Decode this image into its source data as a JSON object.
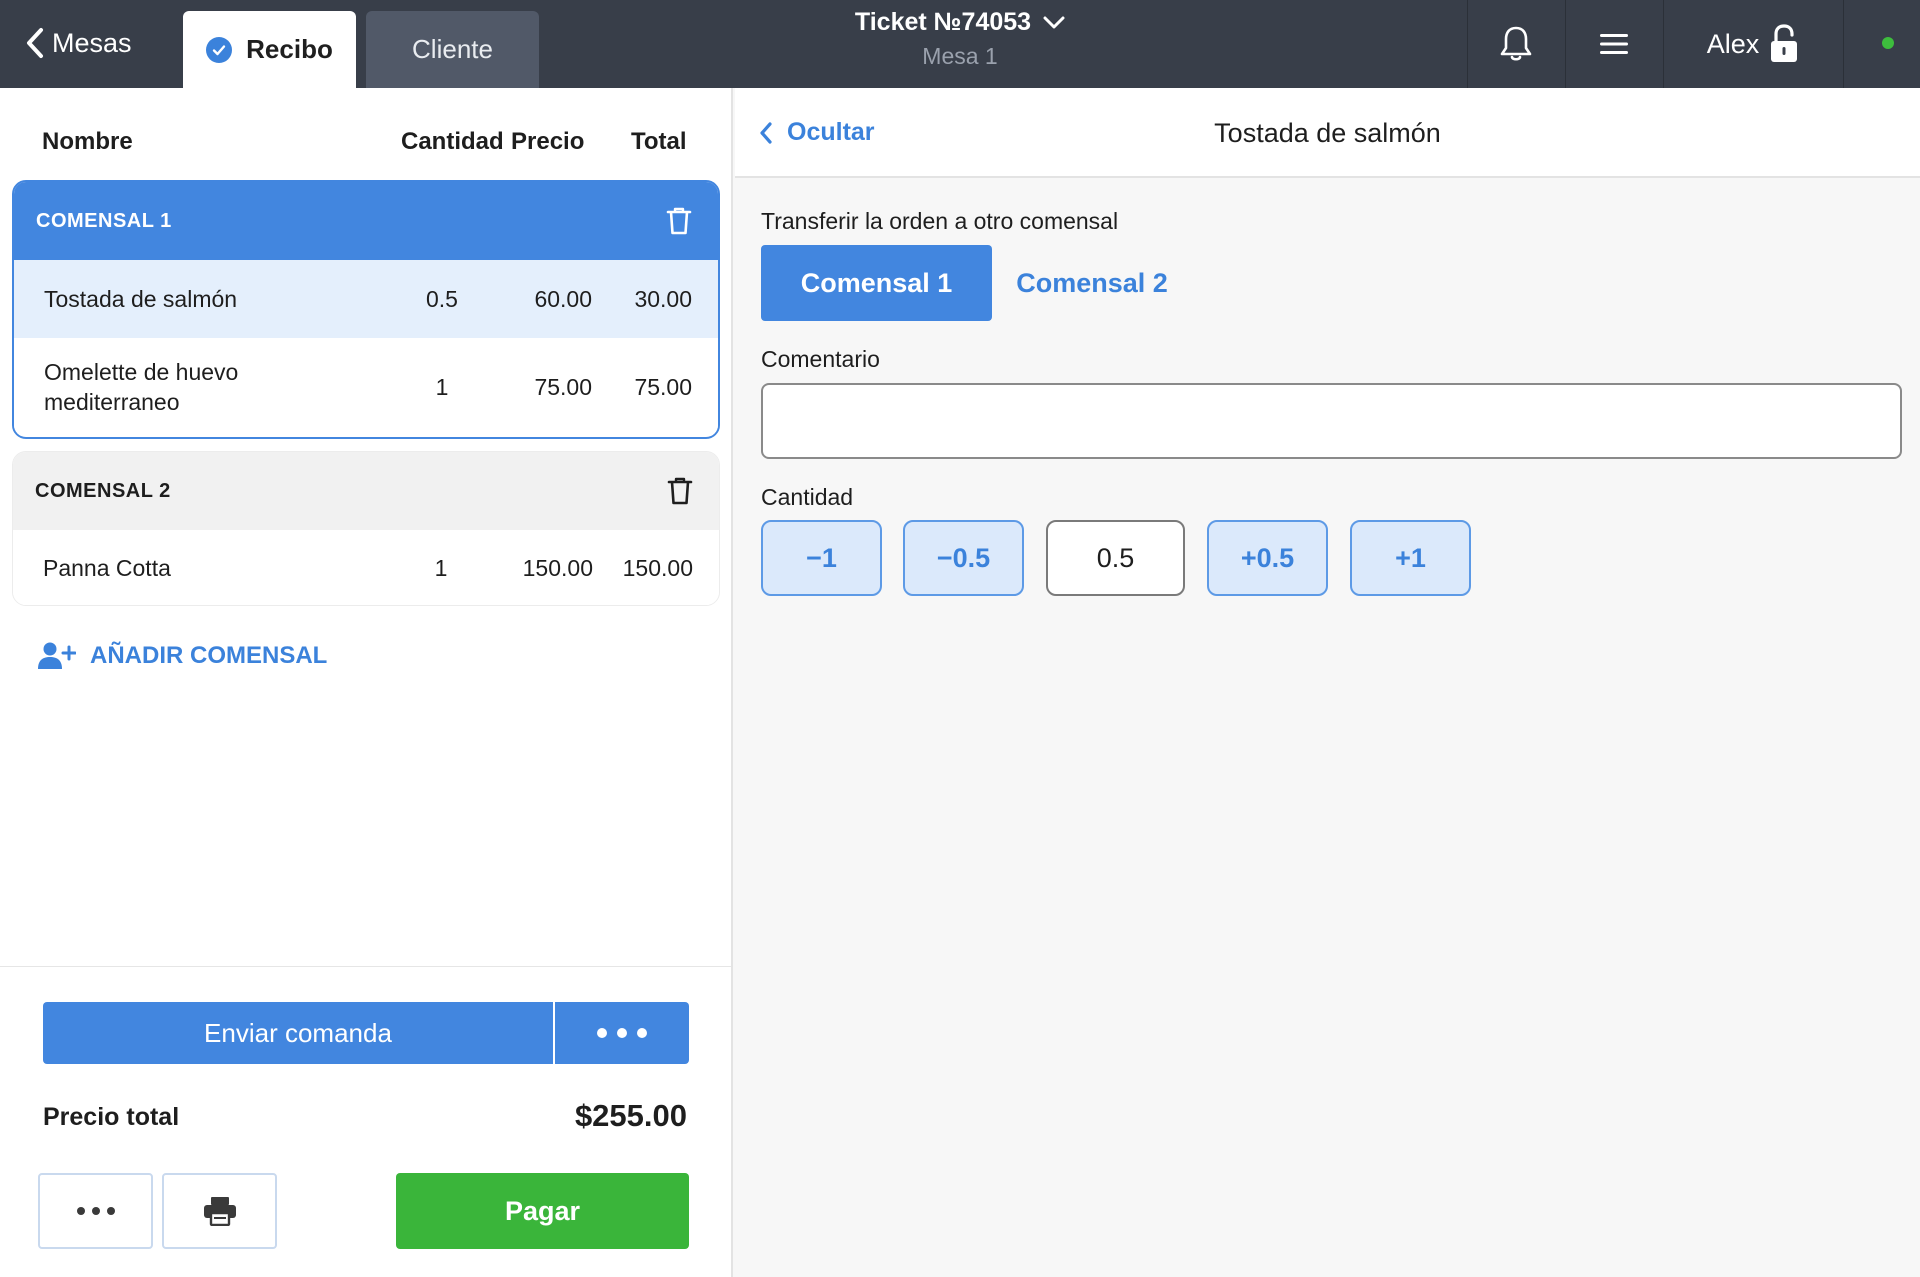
{
  "topbar": {
    "back_label": "Mesas",
    "tabs": [
      {
        "label": "Recibo",
        "active": true
      },
      {
        "label": "Cliente",
        "active": false
      }
    ],
    "ticket_title": "Ticket №74053",
    "ticket_subtitle": "Mesa 1",
    "user_name": "Alex",
    "icons": [
      "chevron-left-icon",
      "check-circle-icon",
      "chevron-down-icon",
      "bell-icon",
      "menu-icon",
      "unlock-icon",
      "online-status-dot"
    ],
    "status_color": "#3dbd3d"
  },
  "receipt": {
    "columns": {
      "name": "Nombre",
      "quantity": "Cantidad",
      "price": "Precio",
      "total": "Total"
    },
    "groups": [
      {
        "title": "COMENSAL 1",
        "selected": true,
        "items": [
          {
            "name": "Tostada de salmón",
            "quantity": "0.5",
            "price": "60.00",
            "total": "30.00",
            "selected": true
          },
          {
            "name": "Omelette de huevo mediterraneo",
            "quantity": "1",
            "price": "75.00",
            "total": "75.00",
            "selected": false
          }
        ]
      },
      {
        "title": "COMENSAL 2",
        "selected": false,
        "items": [
          {
            "name": "Panna Cotta",
            "quantity": "1",
            "price": "150.00",
            "total": "150.00",
            "selected": false
          }
        ]
      }
    ],
    "add_guest_label": "AÑADIR COMENSAL",
    "send_label": "Enviar comanda",
    "total_label": "Precio total",
    "total_value": "$255.00",
    "pay_label": "Pagar"
  },
  "detail": {
    "hide_label": "Ocultar",
    "title": "Tostada de salmón",
    "transfer_label": "Transferir la orden a otro comensal",
    "guests": [
      {
        "label": "Comensal 1",
        "active": true
      },
      {
        "label": "Comensal 2",
        "active": false
      }
    ],
    "comment_label": "Comentario",
    "comment_value": "",
    "quantity_label": "Cantidad",
    "quantity_value": "0.5",
    "quantity_buttons": [
      "−1",
      "−0.5",
      "+0.5",
      "+1"
    ]
  },
  "colors": {
    "accent": "#4286df",
    "topbar": "#383e49",
    "pay": "#3ab53a",
    "selected_row": "#e4effc"
  }
}
